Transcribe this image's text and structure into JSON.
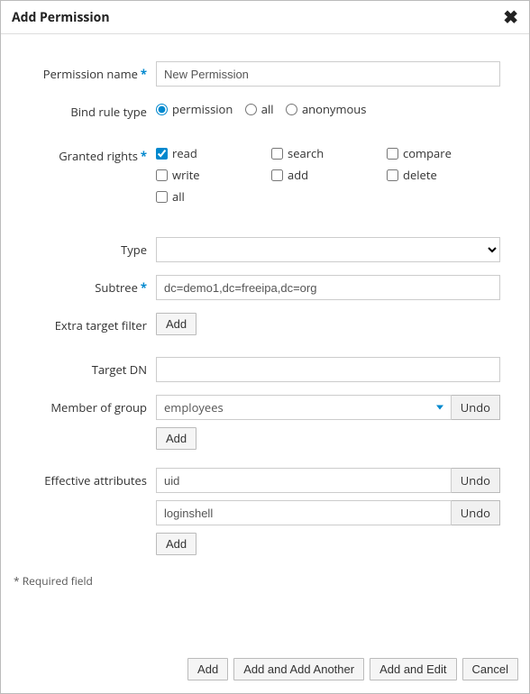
{
  "dialog": {
    "title": "Add Permission"
  },
  "labels": {
    "permission_name": "Permission name",
    "bind_rule_type": "Bind rule type",
    "granted_rights": "Granted rights",
    "type": "Type",
    "subtree": "Subtree",
    "extra_target_filter": "Extra target filter",
    "target_dn": "Target DN",
    "member_of_group": "Member of group",
    "effective_attributes": "Effective attributes",
    "required_field": "* Required field"
  },
  "values": {
    "permission_name": "New Permission",
    "bind_rule_type": "permission",
    "subtree": "dc=demo1,dc=freeipa,dc=org",
    "target_dn": "",
    "type": "",
    "member_of_group": [
      "employees"
    ],
    "effective_attributes": [
      "uid",
      "loginshell"
    ],
    "granted_rights": {
      "read": true,
      "search": false,
      "compare": false,
      "write": false,
      "add": false,
      "delete": false,
      "all": false
    }
  },
  "bind_rule_options": {
    "permission": "permission",
    "all": "all",
    "anonymous": "anonymous"
  },
  "rights_labels": {
    "read": "read",
    "search": "search",
    "compare": "compare",
    "write": "write",
    "add": "add",
    "delete": "delete",
    "all": "all"
  },
  "buttons": {
    "add_small": "Add",
    "undo": "Undo",
    "add": "Add",
    "add_and_add_another": "Add and Add Another",
    "add_and_edit": "Add and Edit",
    "cancel": "Cancel"
  }
}
